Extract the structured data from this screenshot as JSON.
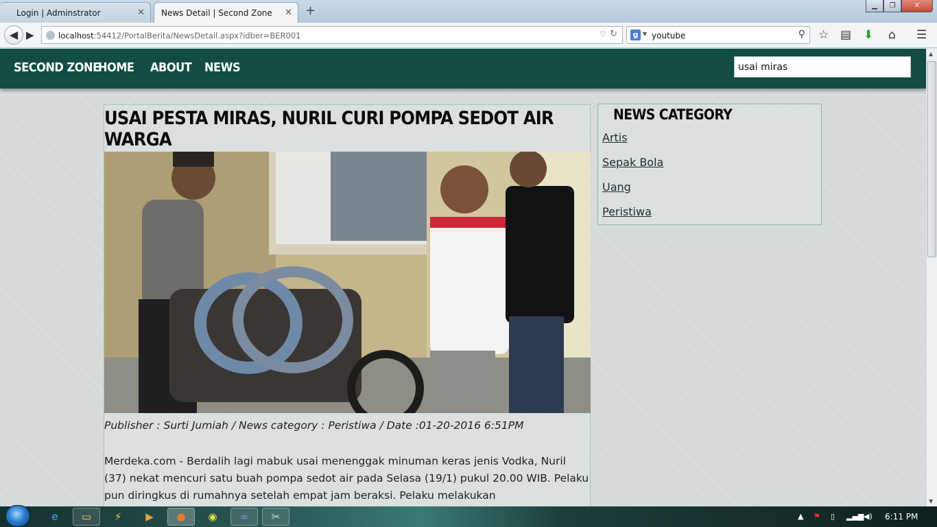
{
  "browser": {
    "tabs": [
      {
        "title": "Login | Adminstrator"
      },
      {
        "title": "News Detail | Second Zone"
      }
    ],
    "url_host": "localhost",
    "url_rest": ":54412/PortalBerita/NewsDetail.aspx?idber=BER001",
    "search_value": "youtube"
  },
  "site": {
    "brand": "SECOND ZONE",
    "menu": [
      "HOME",
      "ABOUT",
      "NEWS"
    ],
    "search_value": "usai miras"
  },
  "article": {
    "title": "USAI PESTA MIRAS, NURIL CURI POMPA SEDOT AIR WARGA",
    "meta": "Publisher : Surti Jumiah / News category : Peristiwa / Date :01-20-2016 6:51PM",
    "body": "Merdeka.com - Berdalih lagi mabuk usai menenggak minuman keras jenis Vodka, Nuril (37) nekat mencuri satu buah pompa sedot air pada Selasa (19/1) pukul 20.00 WIB. Pelaku pun diringkus di rumahnya setelah empat jam beraksi. Pelaku melakukan"
  },
  "sidebar": {
    "heading": "NEWS CATEGORY",
    "categories": [
      "Artis",
      "Sepak Bola",
      "Uang",
      "Peristiwa"
    ]
  },
  "taskbar": {
    "clock": "6:11 PM"
  },
  "colors": {
    "header_bg": "#124c42",
    "page_bg": "#d6dbdc"
  },
  "icons": [
    "back-icon",
    "forward-icon",
    "globe-icon",
    "reload-icon",
    "google-icon",
    "search-icon",
    "star-icon",
    "reading-list-icon",
    "download-icon",
    "home-icon",
    "hamburger-menu-icon",
    "windows-start-icon",
    "ie-icon",
    "explorer-icon",
    "firefox-icon",
    "chrome-icon"
  ]
}
